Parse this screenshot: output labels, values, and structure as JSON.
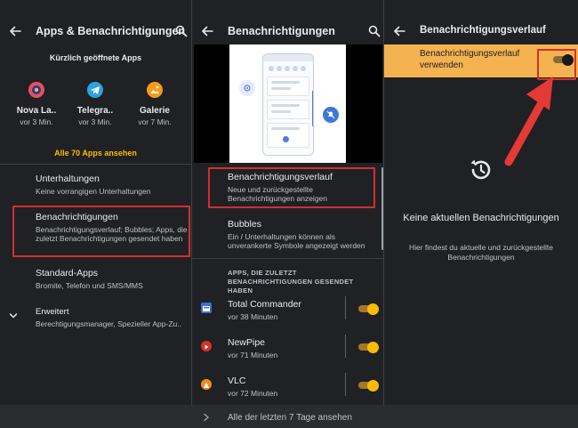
{
  "panel1": {
    "title": "Apps & Benachrichtigungen",
    "recent_title": "Kürzlich geöffnete Apps",
    "apps": [
      {
        "name": "Nova La..",
        "time": "vor 3 Min.",
        "color": "#e8505b"
      },
      {
        "name": "Telegra..",
        "time": "vor 3 Min.",
        "color": "#2aa3e0"
      },
      {
        "name": "Galerie",
        "time": "vor 7 Min.",
        "color": "#f59b16"
      }
    ],
    "all_apps_label": "Alle 70 Apps ansehen",
    "items": [
      {
        "title": "Unterhaltungen",
        "subtitle": "Keine vorrangigen Unterhaltungen"
      },
      {
        "title": "Benachrichtigungen",
        "subtitle": "Benachrichtigungsverlauf; Bubbles; Apps, die zuletzt Benachrichtigungen gesendet haben"
      },
      {
        "title": "Standard-Apps",
        "subtitle": "Bromite, Telefon und SMS/MMS"
      },
      {
        "title": "Erweitert",
        "subtitle": "Berechtigungsmanager, Spezieller App-Zu.."
      }
    ]
  },
  "panel2": {
    "title": "Benachrichtigungen",
    "items": [
      {
        "title": "Benachrichtigungsverlauf",
        "subtitle": "Neue und zurückgestellte Benachrichtigungen anzeigen"
      },
      {
        "title": "Bubbles",
        "subtitle": "Ein / Unterhaltungen können als unverankerte Symbole angezeigt werden"
      }
    ],
    "section_label": "APPS, DIE ZULETZT BENACHRICHTIGUNGEN GESENDET HABEN",
    "recent_apps": [
      {
        "name": "Total Commander",
        "time": "vor 38 Minuten",
        "color": "#3c6fd1",
        "enabled": true
      },
      {
        "name": "NewPipe",
        "time": "vor 71 Minuten",
        "color": "#d93025",
        "enabled": true
      },
      {
        "name": "VLC",
        "time": "vor 72 Minuten",
        "color": "#f28b16",
        "enabled": true
      }
    ]
  },
  "panel3": {
    "title": "Benachrichtigungsverlauf",
    "master_label": "Benachrichtigungsverlauf verwenden",
    "master_enabled": false,
    "empty_title": "Keine aktuellen Benachrichtigungen",
    "empty_subtitle": "Hier findest du aktuelle und zurückgestellte Benachrichtigungen"
  },
  "bottom": {
    "label": "Alle der letzten 7 Tage ansehen"
  },
  "colors": {
    "accent": "#fbbc04",
    "highlight": "#d32f2f",
    "background": "#202124"
  }
}
